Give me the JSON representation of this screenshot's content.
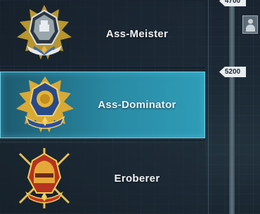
{
  "tiers": [
    {
      "label": "Ass-Meister",
      "icon": "ace-master-badge-icon",
      "selected": false
    },
    {
      "label": "Ass-Dominator",
      "icon": "ace-dominator-badge-icon",
      "selected": true
    },
    {
      "label": "Eroberer",
      "icon": "conqueror-badge-icon",
      "selected": false
    }
  ],
  "progress_track": {
    "marker_top": "4700",
    "marker_mid": "5200",
    "player_avatar_icon": "player-avatar-icon"
  },
  "colors": {
    "selected_row": "#2a8aa4",
    "gold": "#e0b84a",
    "silver": "#c7ced4"
  }
}
